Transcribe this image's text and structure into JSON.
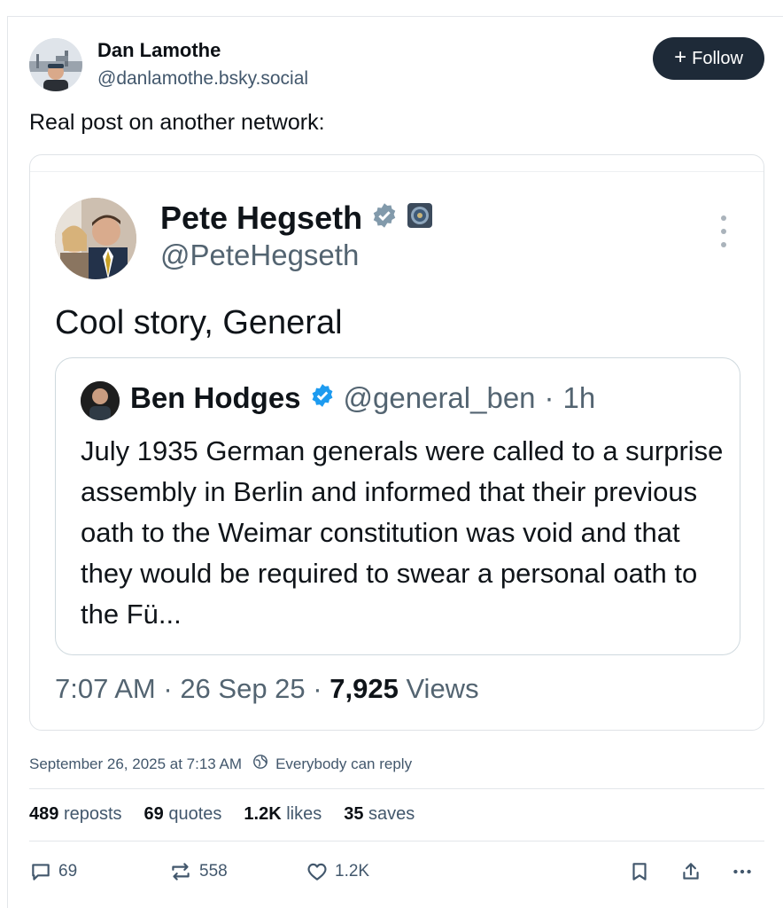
{
  "post": {
    "author_name": "Dan Lamothe",
    "author_handle": "@danlamothe.bsky.social",
    "follow_label": "Follow",
    "text": "Real post on another network:",
    "timestamp": "September 26, 2025 at 7:13 AM",
    "reply_setting": "Everybody can reply"
  },
  "embed": {
    "author_name": "Pete Hegseth",
    "author_handle": "@PeteHegseth",
    "text": "Cool story, General",
    "quoted": {
      "author_name": "Ben Hodges",
      "author_handle": "@general_ben",
      "separator": "·",
      "age": "1h",
      "text": "July 1935 German generals were called to a surprise assembly in Berlin and informed that their previous oath to the Weimar constitution was void and that they would be required to swear a personal oath to the Fü..."
    },
    "time": "7:07 AM",
    "date": "26 Sep 25",
    "views_count": "7,925",
    "views_label": "Views"
  },
  "stats": {
    "reposts_count": "489",
    "reposts_label": "reposts",
    "quotes_count": "69",
    "quotes_label": "quotes",
    "likes_count": "1.2K",
    "likes_label": "likes",
    "saves_count": "35",
    "saves_label": "saves"
  },
  "actions": {
    "reply_count": "69",
    "repost_count": "558",
    "like_count": "1.2K"
  },
  "icons": {
    "verified": "verified-badge-icon",
    "government": "government-seal-icon",
    "reply": "speech-bubble-icon",
    "repost": "repost-arrows-icon",
    "like": "heart-icon",
    "bookmark": "bookmark-icon",
    "share": "share-icon",
    "more": "ellipsis-icon"
  },
  "colors": {
    "follow_bg": "#1e2a38",
    "verified_blue": "#1d9bf0",
    "verified_grey": "#829aab",
    "muted_text": "#42576c"
  }
}
